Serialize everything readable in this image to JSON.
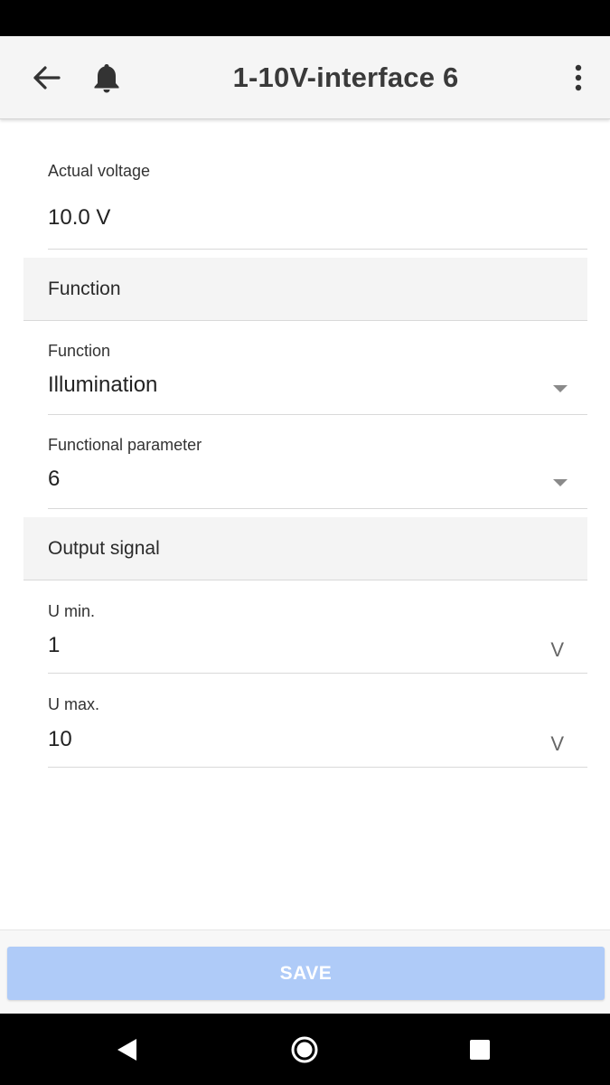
{
  "app_bar": {
    "title": "1-10V-interface 6",
    "icons": {
      "back": "arrow-left-icon",
      "notification": "bell-icon",
      "menu": "more-vertical-icon"
    }
  },
  "actual_voltage": {
    "label": "Actual voltage",
    "value": "10.0 V"
  },
  "function_section": {
    "title": "Function",
    "function_field": {
      "label": "Function",
      "value": "Illumination"
    },
    "parameter_field": {
      "label": "Functional parameter",
      "value": "6"
    }
  },
  "output_section": {
    "title": "Output signal",
    "u_min": {
      "label": "U min.",
      "value": "1",
      "unit": "V"
    },
    "u_max": {
      "label": "U max.",
      "value": "10",
      "unit": "V"
    }
  },
  "save": {
    "label": "SAVE"
  },
  "colors": {
    "save_button": "#afcbf8",
    "app_bar": "#f5f5f5",
    "section_bg": "#f4f4f4"
  },
  "nav_bar": {
    "icons": [
      "nav-back-icon",
      "nav-home-icon",
      "nav-recents-icon"
    ]
  }
}
